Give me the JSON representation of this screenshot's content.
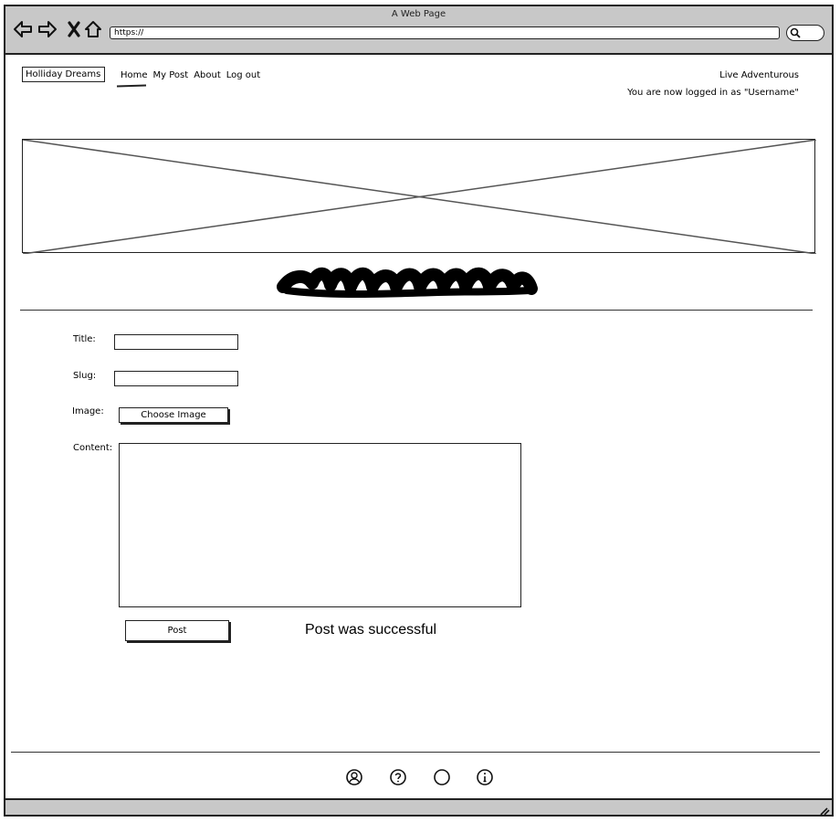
{
  "window": {
    "title": "A Web Page",
    "url": "https://"
  },
  "browser_icons": [
    "back-icon",
    "forward-icon",
    "close-icon",
    "home-icon",
    "search-icon"
  ],
  "header": {
    "brand": "Holliday Dreams",
    "nav": [
      {
        "label": "Home",
        "active": true
      },
      {
        "label": "My Post"
      },
      {
        "label": "About"
      },
      {
        "label": "Log out"
      }
    ],
    "tagline": "Live Adventurous",
    "login_status": "You are now logged in as \"Username\""
  },
  "form": {
    "title_label": "Title:",
    "slug_label": "Slug:",
    "image_label": "Image:",
    "choose_image_label": "Choose Image",
    "content_label": "Content:",
    "post_label": "Post",
    "success_message": "Post was successful"
  },
  "footer_icons": [
    "user-icon",
    "help-icon",
    "circle-icon",
    "info-icon"
  ]
}
